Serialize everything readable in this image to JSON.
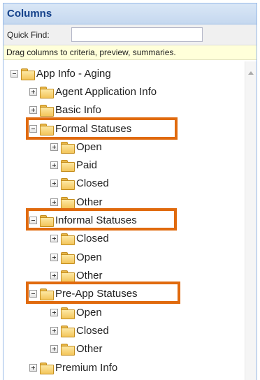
{
  "header": {
    "title": "Columns"
  },
  "quick_find": {
    "label": "Quick Find:",
    "value": "",
    "placeholder": ""
  },
  "hint": "Drag columns to criteria, preview, summaries.",
  "tree": {
    "root": "App Info - Aging",
    "agent_application_info": "Agent Application Info",
    "basic_info": "Basic Info",
    "formal_statuses": "Formal Statuses",
    "formal_open": "Open",
    "formal_paid": "Paid",
    "formal_closed": "Closed",
    "formal_other": "Other",
    "informal_statuses": "Informal Statuses",
    "informal_closed": "Closed",
    "informal_open": "Open",
    "informal_other": "Other",
    "preapp_statuses": "Pre-App Statuses",
    "preapp_open": "Open",
    "preapp_closed": "Closed",
    "preapp_other": "Other",
    "premium_info": "Premium Info"
  },
  "colors": {
    "highlight": "#e06a0e",
    "header_text": "#15428b"
  }
}
